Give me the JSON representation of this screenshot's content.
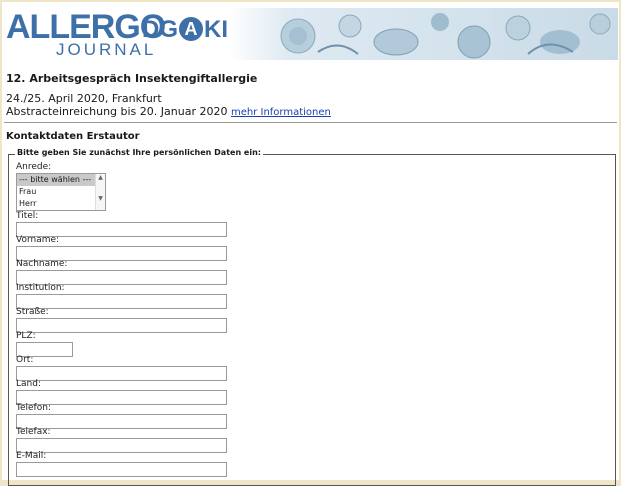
{
  "header": {
    "logo_main": "ALLERGO",
    "logo_sub": "JOURNAL",
    "partner_logo_before": "DG",
    "partner_logo_circle": "A",
    "partner_logo_after": "KI",
    "banner_theme": "pollen-illustration"
  },
  "event": {
    "title": "12. Arbeitsgespräch Insektengiftallergie",
    "date_location": "24./25. April 2020, Frankfurt",
    "deadline": "Abstracteinreichung bis 20. Januar 2020",
    "more_info_link": "mehr Informationen"
  },
  "form": {
    "section_title": "Kontaktdaten Erstautor",
    "legend": "Bitte geben Sie zunächst Ihre persönlichen Daten ein:",
    "salutation": {
      "label": "Anrede:",
      "options": [
        "--- bitte wählen ---",
        "Frau",
        "Herr"
      ],
      "selected": "--- bitte wählen ---"
    },
    "fields": {
      "title": "Titel:",
      "first_name": "Vorname:",
      "last_name": "Nachname:",
      "institution": "Institution:",
      "street": "Straße:",
      "zip": "PLZ:",
      "city": "Ort:",
      "country": "Land:",
      "phone": "Telefon:",
      "fax": "Telefax:",
      "email": "E-Mail:"
    }
  },
  "colors": {
    "brand_blue": "#3d6fa8",
    "link_blue": "#1a3fb0",
    "outer_background": "#efe6c8"
  }
}
